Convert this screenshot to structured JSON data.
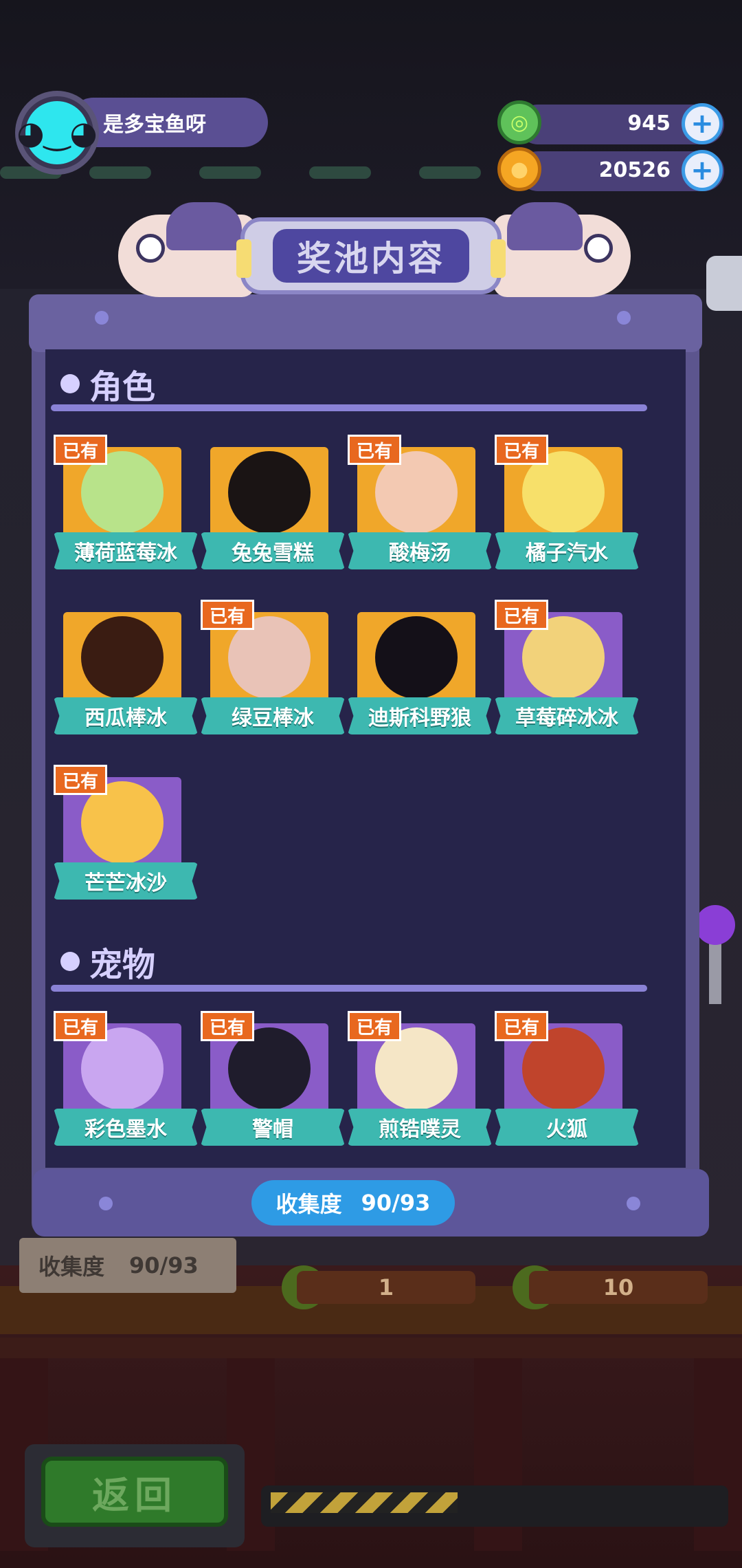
{
  "player": {
    "name": "是多宝鱼呀",
    "avatar_icon": "cat-face-icon"
  },
  "currencies": [
    {
      "name": "green-donut",
      "value": "945",
      "icon": "donut-icon",
      "color": "#5fc25a"
    },
    {
      "name": "gold-planet",
      "value": "20526",
      "icon": "planet-coin-icon",
      "color": "#f5a623"
    }
  ],
  "panel": {
    "title": "奖池内容",
    "collection_label": "收集度",
    "collection_value": "90/93"
  },
  "sections": [
    {
      "title": "角色",
      "items": [
        {
          "name": "薄荷蓝莓冰",
          "owned": true,
          "bg": "gold",
          "art": "#b8e38a"
        },
        {
          "name": "兔兔雪糕",
          "owned": false,
          "bg": "gold",
          "art": "#1a1414"
        },
        {
          "name": "酸梅汤",
          "owned": true,
          "bg": "gold",
          "art": "#f3c9b2"
        },
        {
          "name": "橘子汽水",
          "owned": true,
          "bg": "gold",
          "art": "#f7e06a"
        },
        {
          "name": "西瓜棒冰",
          "owned": false,
          "bg": "gold",
          "art": "#3a1c12"
        },
        {
          "name": "绿豆棒冰",
          "owned": true,
          "bg": "gold",
          "art": "#e9c3b7"
        },
        {
          "name": "迪斯科野狼",
          "owned": false,
          "bg": "gold",
          "art": "#141018"
        },
        {
          "name": "草莓碎冰冰",
          "owned": true,
          "bg": "purple",
          "art": "#f2d27a"
        },
        {
          "name": "芒芒冰沙",
          "owned": true,
          "bg": "purple",
          "art": "#f8c24a"
        }
      ]
    },
    {
      "title": "宠物",
      "items": [
        {
          "name": "彩色墨水",
          "owned": true,
          "bg": "purple",
          "art": "#c9a6f0"
        },
        {
          "name": "警帽",
          "owned": true,
          "bg": "purple",
          "art": "#1f1c2c"
        },
        {
          "name": "煎锆噗灵",
          "owned": true,
          "bg": "purple",
          "art": "#f5e6c6"
        },
        {
          "name": "火狐",
          "owned": true,
          "bg": "purple",
          "art": "#c0442c"
        }
      ]
    }
  ],
  "owned_tag": "已有",
  "background": {
    "collect_label": "收集度",
    "collect_value": "90/93",
    "draw_one": "1",
    "draw_ten": "10",
    "back_label": "返回"
  }
}
